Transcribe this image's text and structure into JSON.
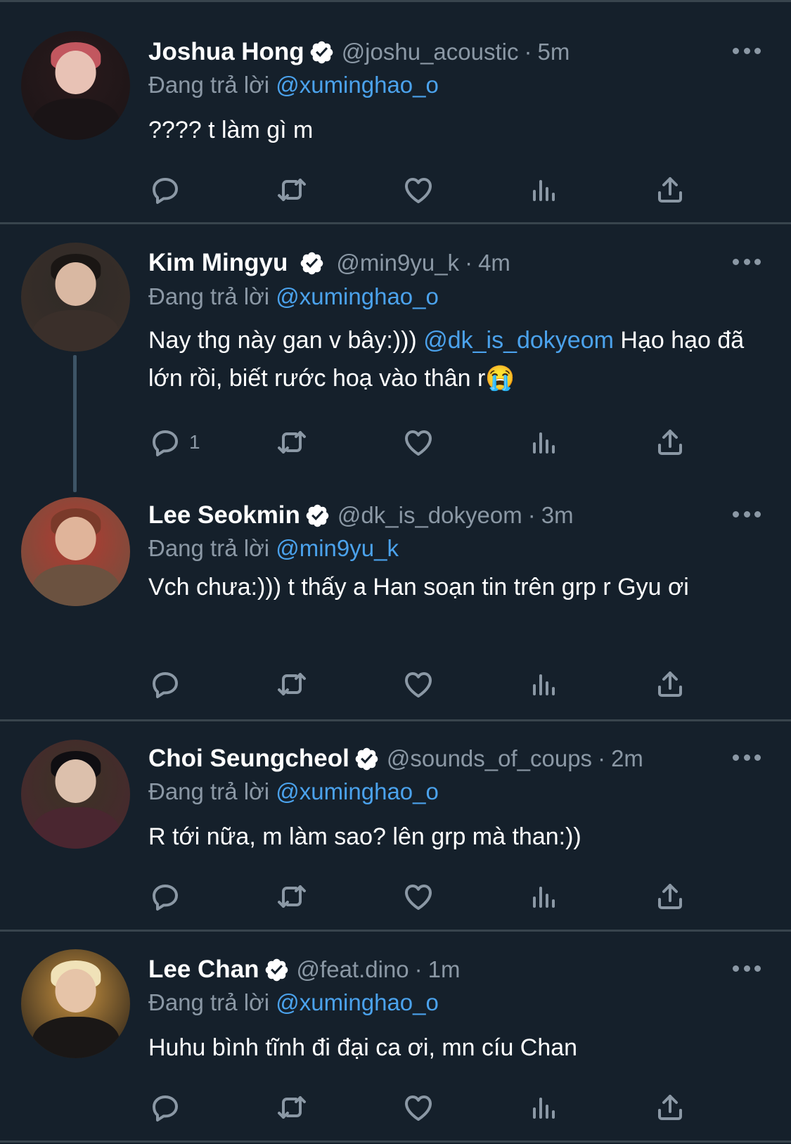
{
  "tweets": [
    {
      "name": "Joshua Hong",
      "handle": "@joshu_acoustic",
      "time": "5m",
      "replying_label": "Đang trả lời",
      "replying_to": "@xuminghao_o",
      "text_parts": [
        "???? t làm gì m"
      ],
      "reply_count": "",
      "avatar_colors": [
        "#2a1a1c",
        "#c2575f",
        "#e8c2b5",
        "#1a1416"
      ]
    },
    {
      "name": "Kim Mingyu",
      "handle": "@min9yu_k",
      "time": "4m",
      "replying_label": "Đang trả lời",
      "replying_to": "@xuminghao_o",
      "text_parts": [
        "Nay thg này gan v bây:))) ",
        "@dk_is_dokyeom",
        " Hạo hạo đã lớn rồi, biết rước hoạ vào thân r",
        "😭"
      ],
      "reply_count": "1",
      "avatar_colors": [
        "#2f2a26",
        "#1a1614",
        "#d9b8a2",
        "#3a2f2a"
      ]
    },
    {
      "name": "Lee Seokmin",
      "handle": "@dk_is_dokyeom",
      "time": "3m",
      "replying_label": "Đang trả lời",
      "replying_to": "@min9yu_k",
      "text_parts": [
        "Vch chưa:))) t thấy a Han soạn tin trên grp r Gyu ơi"
      ],
      "reply_count": "",
      "avatar_colors": [
        "#b23a30",
        "#7a3a2a",
        "#e0b49a",
        "#6b5240"
      ]
    },
    {
      "name": "Choi Seungcheol",
      "handle": "@sounds_of_coups",
      "time": "2m",
      "replying_label": "Đang trả lời",
      "replying_to": "@xuminghao_o",
      "text_parts": [
        "R tới nữa, m làm sao? lên grp mà than:))"
      ],
      "reply_count": "",
      "avatar_colors": [
        "#3b3325",
        "#0f0e12",
        "#dcc0ac",
        "#4a2630"
      ]
    },
    {
      "name": "Lee Chan",
      "handle": "@feat.dino",
      "time": "1m",
      "replying_label": "Đang trả lời",
      "replying_to": "@xuminghao_o",
      "text_parts": [
        "Huhu bình tĩnh đi đại ca ơi, mn cíu Chan"
      ],
      "reply_count": "",
      "avatar_colors": [
        "#c7913f",
        "#f0e2b8",
        "#e6c4a8",
        "#1a1716"
      ]
    }
  ],
  "colors": {
    "background": "#15202b",
    "divider": "#38444d",
    "secondary_text": "#8b98a5",
    "mention": "#4ba2ec",
    "thread_line": "#3d5466"
  },
  "icons": [
    "reply-icon",
    "retweet-icon",
    "like-icon",
    "views-icon",
    "share-icon",
    "verified-icon",
    "more-icon"
  ]
}
